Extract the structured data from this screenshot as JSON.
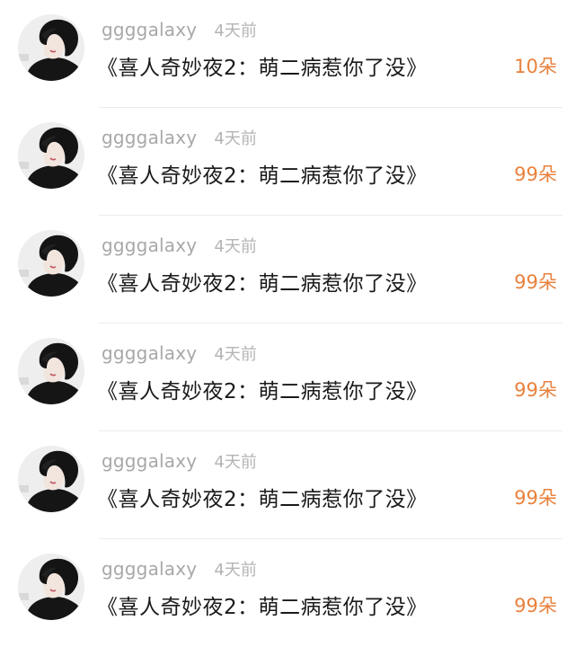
{
  "colors": {
    "accent": "#e9813d",
    "username": "#a8a8a8",
    "timestamp": "#b4b4b4",
    "title": "#1a1a1a",
    "divider": "#ececec"
  },
  "items": [
    {
      "username": "ggggalaxy",
      "time": "4天前",
      "title": "《喜人奇妙夜2：萌二病惹你了没》",
      "flowers": "10朵",
      "avatar_icon": "avatar-icon"
    },
    {
      "username": "ggggalaxy",
      "time": "4天前",
      "title": "《喜人奇妙夜2：萌二病惹你了没》",
      "flowers": "99朵",
      "avatar_icon": "avatar-icon"
    },
    {
      "username": "ggggalaxy",
      "time": "4天前",
      "title": "《喜人奇妙夜2：萌二病惹你了没》",
      "flowers": "99朵",
      "avatar_icon": "avatar-icon"
    },
    {
      "username": "ggggalaxy",
      "time": "4天前",
      "title": "《喜人奇妙夜2：萌二病惹你了没》",
      "flowers": "99朵",
      "avatar_icon": "avatar-icon"
    },
    {
      "username": "ggggalaxy",
      "time": "4天前",
      "title": "《喜人奇妙夜2：萌二病惹你了没》",
      "flowers": "99朵",
      "avatar_icon": "avatar-icon"
    },
    {
      "username": "ggggalaxy",
      "time": "4天前",
      "title": "《喜人奇妙夜2：萌二病惹你了没》",
      "flowers": "99朵",
      "avatar_icon": "avatar-icon"
    }
  ]
}
